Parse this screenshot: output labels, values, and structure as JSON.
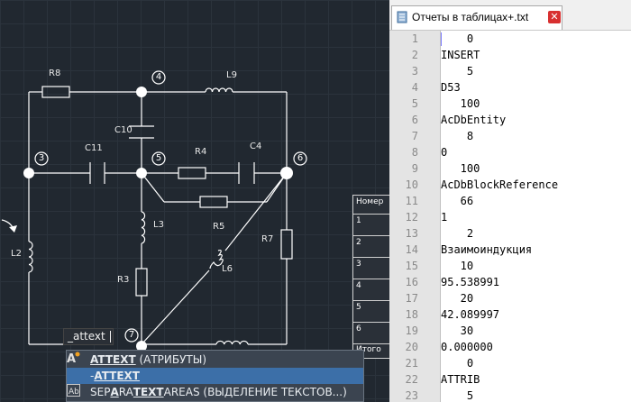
{
  "cad": {
    "components": {
      "r8": "R8",
      "l9": "L9",
      "c10": "C10",
      "c11": "C11",
      "r4": "R4",
      "c4": "C4",
      "l3": "L3",
      "r5": "R5",
      "r7": "R7",
      "l2": "L2",
      "r3": "R3",
      "l6": "L6"
    },
    "nodes": {
      "n3": "3",
      "n4": "4",
      "n5": "5",
      "n6": "6",
      "n7": "7"
    },
    "table": {
      "header": "Номер",
      "rows": [
        "1",
        "2",
        "3",
        "4",
        "5",
        "6"
      ],
      "footer": "Итого"
    },
    "command": {
      "input_value": "_attext",
      "suggestions": [
        {
          "bold": "ATTEXT",
          "rest": " (АТРИБУТЫ)",
          "icon": "attext-icon"
        },
        {
          "pre": "-",
          "bold": "ATTEXT",
          "rest": "",
          "icon": ""
        },
        {
          "pre": "SEP",
          "bold": "A",
          "mid1": "RA",
          "bold2": "T",
          "mid2": "",
          "bold3": "EXT",
          "rest": "AREAS (ВЫДЕЛЕНИЕ ТЕКСТОВ...)",
          "icon": "separate-text-icon"
        }
      ],
      "selected_index": 1
    },
    "colors": {
      "background": "#212830",
      "wire": "#ffffff",
      "grid": "#2b333c",
      "selection": "#3c6fa8"
    }
  },
  "notepad": {
    "tab_title": "Отчеты в таблицах+.txt",
    "close_label": "✕",
    "lines": [
      "    0",
      "INSERT",
      "    5",
      "D53",
      "   100",
      "AcDbEntity",
      "    8",
      "0",
      "   100",
      "AcDbBlockReference",
      "   66",
      "1",
      "    2",
      "Взаимоиндукция",
      "   10",
      "95.538991",
      "   20",
      "42.089997",
      "   30",
      "0.000000",
      "    0",
      "ATTRIB",
      "    5"
    ],
    "line_numbers": [
      "1",
      "2",
      "3",
      "4",
      "5",
      "6",
      "7",
      "8",
      "9",
      "10",
      "11",
      "12",
      "13",
      "14",
      "15",
      "16",
      "17",
      "18",
      "19",
      "20",
      "21",
      "22",
      "23"
    ]
  }
}
